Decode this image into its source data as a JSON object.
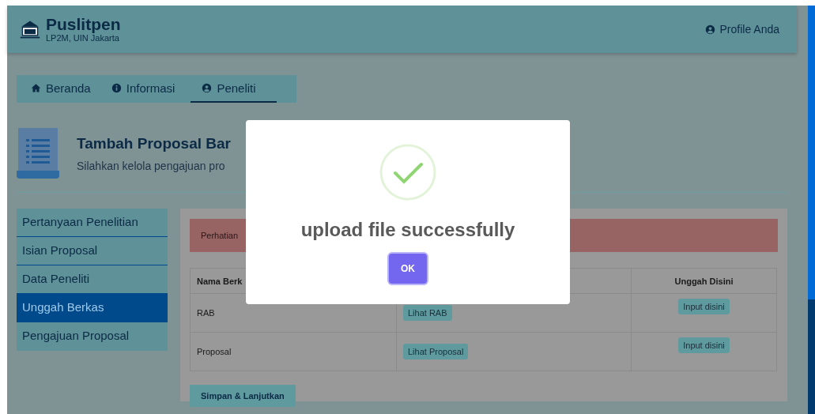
{
  "header": {
    "title": "Puslitpen",
    "subtitle": "LP2M, UIN Jakarta",
    "profile": "Profile Anda"
  },
  "tabs": [
    {
      "label": "Beranda",
      "selected": false
    },
    {
      "label": "Informasi",
      "selected": false
    },
    {
      "label": "Peneliti",
      "selected": true
    }
  ],
  "page_heading": {
    "title": "Tambah Proposal Bar",
    "subtitle": "Silahkan kelola pengajuan pro"
  },
  "sidebar": {
    "items": [
      {
        "label": "Pertanyaan Penelitian",
        "selected": false
      },
      {
        "label": "Isian Proposal",
        "selected": false
      },
      {
        "label": "Data Peneliti",
        "selected": false
      },
      {
        "label": "Unggah Berkas",
        "selected": true
      },
      {
        "label": "Pengajuan Proposal",
        "selected": false
      }
    ]
  },
  "alert": {
    "text": "Perhatian"
  },
  "table": {
    "columns": {
      "column_1": "Nama Berk",
      "column_3": "Unggah Disini"
    },
    "rows": [
      {
        "name": "RAB",
        "view": "Lihat RAB",
        "upload": "Input disini"
      },
      {
        "name": "Proposal",
        "view": "Lihat Proposal",
        "upload": "Input disini"
      }
    ]
  },
  "save_button": "Simpan & Lanjutkan",
  "dialog": {
    "message": "upload file successfully",
    "button": "OK"
  }
}
